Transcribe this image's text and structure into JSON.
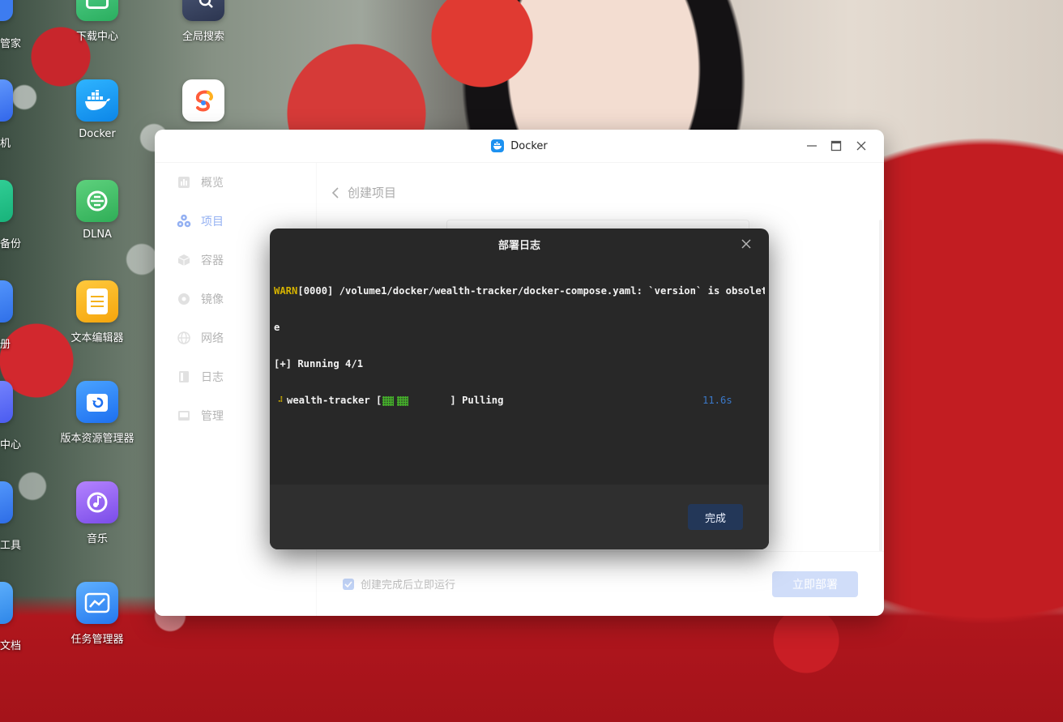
{
  "desktop": {
    "icons": [
      {
        "label": "下载中心",
        "icon": "download-center-icon"
      },
      {
        "label": "全局搜索",
        "icon": "global-search-icon"
      },
      {
        "label": "Docker",
        "icon": "docker-icon"
      },
      {
        "label": "",
        "icon": "app-s-logo-icon"
      },
      {
        "label": "DLNA",
        "icon": "dlna-icon"
      },
      {
        "label": "文本编辑器",
        "icon": "text-editor-icon"
      },
      {
        "label": "版本资源管理器",
        "icon": "version-explorer-icon"
      },
      {
        "label": "音乐",
        "icon": "music-icon"
      },
      {
        "label": "任务管理器",
        "icon": "task-manager-icon"
      }
    ],
    "partial_labels": [
      "管家",
      "机",
      "备份",
      "册",
      "中心",
      "工具",
      "文档"
    ]
  },
  "window": {
    "title": "Docker",
    "controls": [
      "minimize-icon",
      "maximize-icon",
      "close-icon"
    ]
  },
  "sidebar": {
    "items": [
      {
        "label": "概览",
        "icon": "overview-icon",
        "active": false
      },
      {
        "label": "项目",
        "icon": "project-icon",
        "active": true
      },
      {
        "label": "容器",
        "icon": "container-icon",
        "active": false
      },
      {
        "label": "镜像",
        "icon": "image-icon",
        "active": false
      },
      {
        "label": "网络",
        "icon": "network-icon",
        "active": false
      },
      {
        "label": "日志",
        "icon": "log-icon",
        "active": false
      },
      {
        "label": "管理",
        "icon": "manage-icon",
        "active": false
      }
    ]
  },
  "main": {
    "breadcrumb": "创建项目",
    "run_after_create_label": "创建完成后立即运行",
    "run_after_create_checked": true,
    "deploy_button": "立即部署"
  },
  "modal": {
    "title": "部署日志",
    "log": {
      "warn_tag": "WARN",
      "warn_text": "[0000] /volume1/docker/wealth-tracker/docker-compose.yaml: `version` is obsolet",
      "warn_wrap": "e",
      "running": "[+] Running 4/1",
      "service_name": "wealth-tracker [",
      "service_status": "] Pulling",
      "elapsed": "11.6s"
    },
    "done_button": "完成"
  },
  "colors": {
    "accent": "#3b6fe8",
    "warn": "#d6b300",
    "timer": "#3b78c8",
    "progress": "#45b02a"
  }
}
